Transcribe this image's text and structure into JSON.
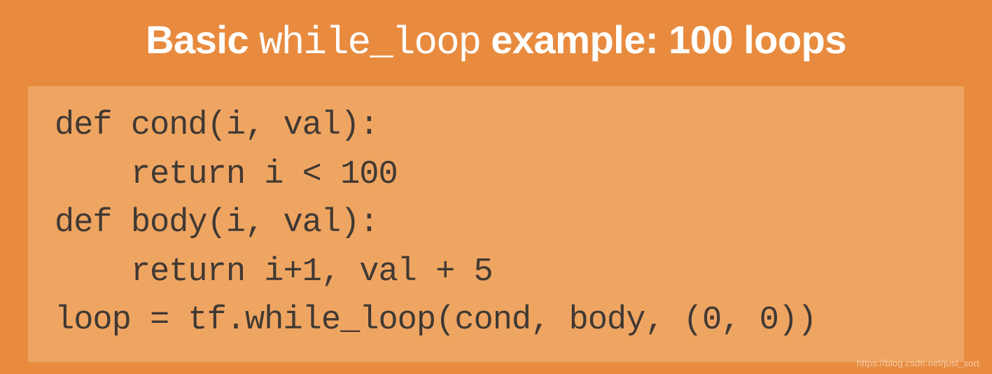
{
  "title": {
    "part1": "Basic ",
    "mono": "while_loop",
    "part2": " example: 100 loops"
  },
  "code": "def cond(i, val):\n    return i < 100\ndef body(i, val):\n    return i+1, val + 5\nloop = tf.while_loop(cond, body, (0, 0))",
  "watermark": "https://blog.csdn.net/just_sort"
}
